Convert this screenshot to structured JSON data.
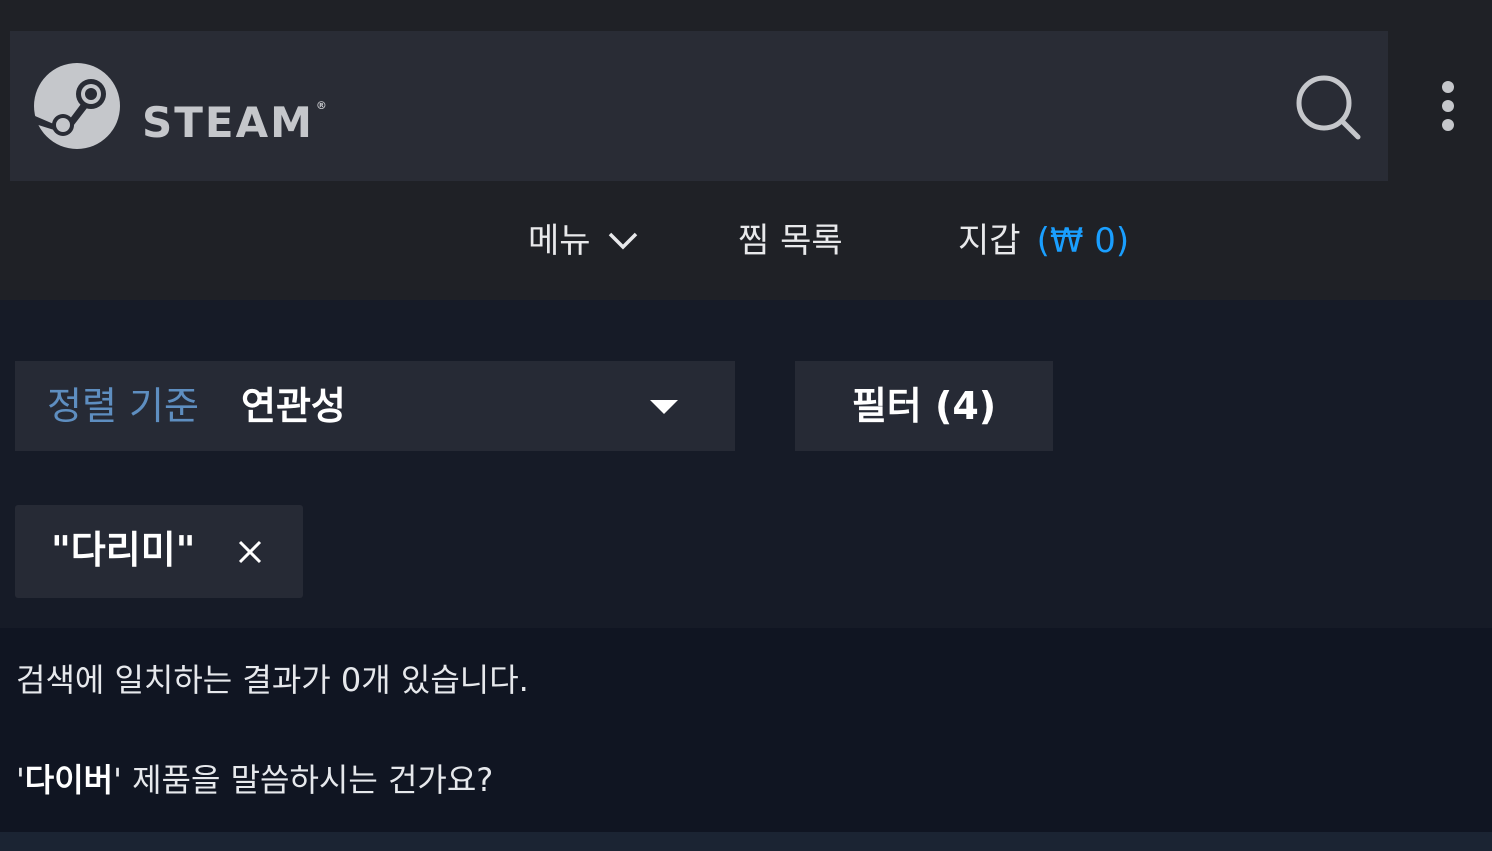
{
  "header": {
    "brand": "STEAM",
    "brand_mark": "®",
    "logo_icon": "steam-logo-icon",
    "search_icon": "search-icon",
    "more_icon": "more-vertical-icon"
  },
  "nav": {
    "menu_label": "메뉴",
    "wishlist_label": "찜 목록",
    "wallet_label": "지갑",
    "wallet_amount": "(₩ 0)"
  },
  "controls": {
    "sort_label": "정렬 기준",
    "sort_value": "연관성",
    "filter_label": "필터 (4)",
    "search_tag": "\"다리미\""
  },
  "results": {
    "message": "검색에 일치하는 결과가 0개 있습니다.",
    "suggest_quote_open": "'",
    "suggest_word": "다이버",
    "suggest_rest": "' 제품을 말씀하시는 건가요?"
  },
  "colors": {
    "accent_blue": "#1a9fff",
    "sort_label_blue": "#5e8ec0",
    "header_bg": "#292c35",
    "topbar_bg": "#1f2126",
    "page_bg": "#161b27"
  }
}
